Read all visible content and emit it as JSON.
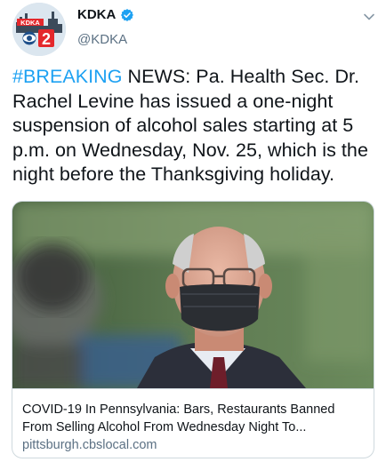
{
  "author": {
    "display_name": "KDKA",
    "handle": "@KDKA",
    "verified": true,
    "avatar_logo_text": "KDKA 2"
  },
  "tweet": {
    "hashtag": "#BREAKING",
    "text": " NEWS: Pa. Health Sec. Dr. Rachel Levine has issued a one-night suspension of alcohol sales starting at 5 p.m. on Wednesday, Nov. 25, which is the night before the Thanksgiving holiday."
  },
  "card": {
    "title": "COVID-19 In Pennsylvania: Bars, Restaurants Banned From Selling Alcohol From Wednesday Night To...",
    "domain": "pittsburgh.cbslocal.com"
  },
  "icons": {
    "verified": "verified-badge-icon",
    "caret": "chevron-down-icon"
  },
  "colors": {
    "accent": "#1da1f2",
    "text": "#0f1419",
    "secondary_text": "#5b7083",
    "border": "#cfd9de"
  }
}
